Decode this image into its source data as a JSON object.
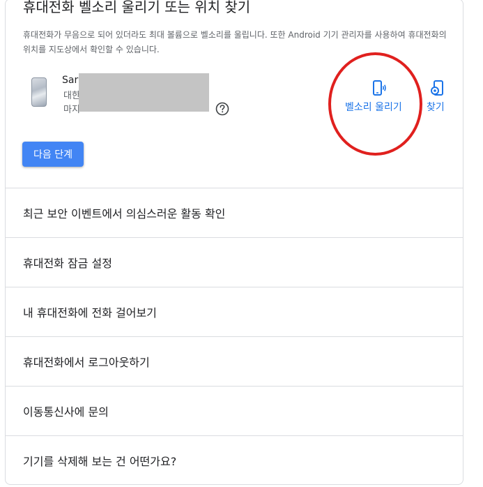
{
  "section": {
    "title": "휴대전화 벨소리 울리기 또는 위치 찾기",
    "description": "휴대전화가 무음으로 되어 있더라도 최대 볼륨으로 벨소리를 울립니다. 또한 Android 기기 관리자를 사용하여 휴대전화의 위치를 지도상에서 확인할 수 있습니다."
  },
  "device": {
    "name_partial": "Sar",
    "location_partial": "대한",
    "time_partial": "마지"
  },
  "actions": {
    "ring_label": "벨소리 울리기",
    "find_label": "찾기"
  },
  "next_button": "다음 단계",
  "list_items": [
    "최근 보안 이벤트에서 의심스러운 활동 확인",
    "휴대전화 잠금 설정",
    "내 휴대전화에 전화 걸어보기",
    "휴대전화에서 로그아웃하기",
    "이동통신사에 문의",
    "기기를 삭제해 보는 건 어떤가요?"
  ],
  "colors": {
    "accent": "#1a73e8",
    "button": "#4285f4",
    "annotation": "#e0201e",
    "divider": "#dadce0"
  },
  "icons": {
    "device": "phone-image",
    "help": "help-circle-icon",
    "ring": "phone-ring-icon",
    "find": "phone-locate-icon"
  }
}
